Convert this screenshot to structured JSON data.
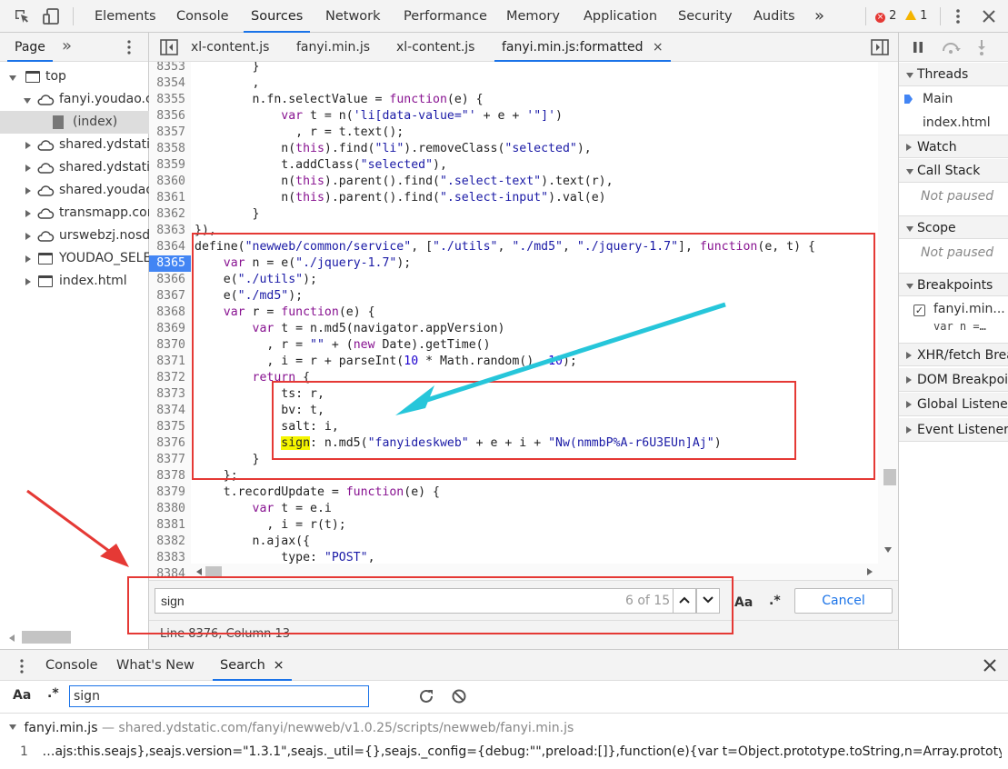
{
  "toolbar": {
    "tabs": [
      "Elements",
      "Console",
      "Sources",
      "Network",
      "Performance",
      "Memory",
      "Application",
      "Security",
      "Audits"
    ],
    "active_tab": "Sources",
    "more": "»",
    "error_count": "2",
    "warning_count": "1"
  },
  "navigator": {
    "tab": "Page",
    "more": "»",
    "tree": [
      {
        "label": "top"
      },
      {
        "label": "fanyi.youdao.com"
      },
      {
        "label": "(index)"
      },
      {
        "label": "shared.ydstatic.com"
      },
      {
        "label": "shared.ydstatic.com"
      },
      {
        "label": "shared.youdao.com"
      },
      {
        "label": "transmapp.com"
      },
      {
        "label": "urswebzj.nosdn"
      },
      {
        "label": "YOUDAO_SELECT"
      },
      {
        "label": "index.html"
      }
    ]
  },
  "editor": {
    "tabs": [
      "xl-content.js",
      "fanyi.min.js",
      "xl-content.js",
      "fanyi.min.js:formatted"
    ],
    "active_tab": "fanyi.min.js:formatted",
    "close_icon": "×",
    "line_numbers": [
      "8353",
      "8354",
      "8355",
      "8356",
      "8357",
      "8358",
      "8359",
      "8360",
      "8361",
      "8362",
      "8363",
      "8364",
      "8365",
      "8366",
      "8367",
      "8368",
      "8369",
      "8370",
      "8371",
      "8372",
      "8373",
      "8374",
      "8375",
      "8376",
      "8377",
      "8378",
      "8379",
      "8380",
      "8381",
      "8382",
      "8383",
      "8384"
    ],
    "current_line": "8365",
    "search": {
      "value": "sign",
      "count": "6 of 15",
      "aa": "Aa",
      "regex": ".*",
      "cancel": "Cancel"
    },
    "status": "Line 8376, Column 13"
  },
  "sidebar": {
    "sections": {
      "threads": "Threads",
      "main": "Main",
      "index_html": "index.html",
      "watch": "Watch",
      "call_stack": "Call Stack",
      "not_paused_1": "Not paused",
      "scope": "Scope",
      "not_paused_2": "Not paused",
      "breakpoints": "Breakpoints",
      "bp_file": "fanyi.min...",
      "bp_code": "var n =…",
      "xhr": "XHR/fetch Breakpoints",
      "dom": "DOM Breakpoints",
      "global": "Global Listeners",
      "event": "Event Listener Breakpoints"
    }
  },
  "drawer": {
    "tabs": [
      "Console",
      "What's New",
      "Search"
    ],
    "active_tab": "Search",
    "search_value": "sign",
    "aa": "Aa",
    "regex": ".*",
    "result_file": "fanyi.min.js",
    "result_path": "— shared.ydstatic.com/fanyi/newweb/v1.0.25/scripts/newweb/fanyi.min.js",
    "result_line_no": "1",
    "result_line": "…ajs:this.seajs},seajs.version=\"1.3.1\",seajs._util={},seajs._config={debug:\"\",preload:[]},function(e){var t=Object.prototype.toString,n=Array.prototype;e.isString=fu…"
  },
  "colors": {
    "annotation_red": "#e53935",
    "annotation_cyan": "#26c6da",
    "accent": "#1a73e8",
    "highlight": "#f5f500"
  }
}
